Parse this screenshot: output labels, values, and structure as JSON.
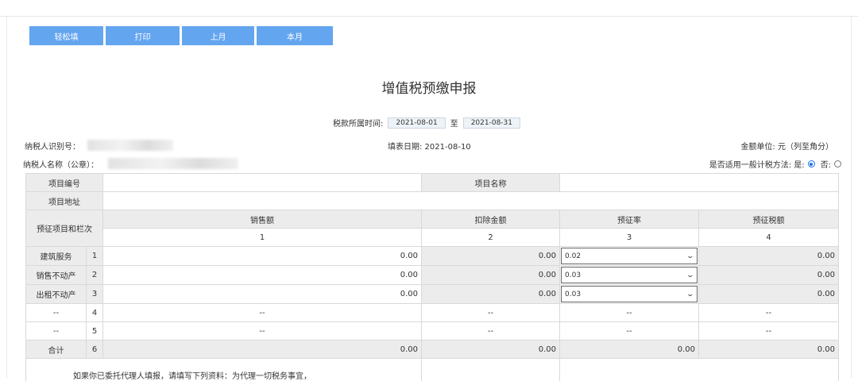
{
  "toolbar": {
    "buttons": [
      {
        "label": "轻松填"
      },
      {
        "label": "打印"
      },
      {
        "label": "上月"
      },
      {
        "label": "本月"
      }
    ]
  },
  "title": "增值税预缴申报",
  "period": {
    "label": "税款所属时间:",
    "start": "2021-08-01",
    "sep": "至",
    "end": "2021-08-31"
  },
  "taxpayer": {
    "tin_label": "纳税人识别号：",
    "name_label": "纳税人名称（公章）：",
    "fill_date": "填表日期: 2021-08-10",
    "unit": "金额单位: 元（列至角分）",
    "method_label": "是否适用一般计税方法: 是:",
    "method_no": "否:"
  },
  "table": {
    "project_no": "项目编号",
    "project_name": "项目名称",
    "project_addr": "项目地址",
    "item_header": "预征项目和栏次",
    "cols": [
      "销售额",
      "扣除金额",
      "预征率",
      "预征税额"
    ],
    "col_nums": [
      "1",
      "2",
      "3",
      "4"
    ],
    "rows": [
      {
        "name": "建筑服务",
        "no": "1",
        "sales": "0.00",
        "deduct": "0.00",
        "rate": "0.02",
        "tax": "0.00"
      },
      {
        "name": "销售不动产",
        "no": "2",
        "sales": "0.00",
        "deduct": "0.00",
        "rate": "0.03",
        "tax": "0.00"
      },
      {
        "name": "出租不动产",
        "no": "3",
        "sales": "0.00",
        "deduct": "0.00",
        "rate": "0.03",
        "tax": "0.00"
      },
      {
        "name": "--",
        "no": "4",
        "sales": "--",
        "deduct": "--",
        "rate": "--",
        "tax": "--"
      },
      {
        "name": "--",
        "no": "5",
        "sales": "--",
        "deduct": "--",
        "rate": "--",
        "tax": "--"
      }
    ],
    "total": {
      "name": "合计",
      "no": "6",
      "sales": "0.00",
      "deduct": "0.00",
      "rate": "0.00",
      "tax": "0.00"
    },
    "footer_note": "如果你已委托代理人填报，请填写下列资料：为代理一切税务事宜，"
  }
}
